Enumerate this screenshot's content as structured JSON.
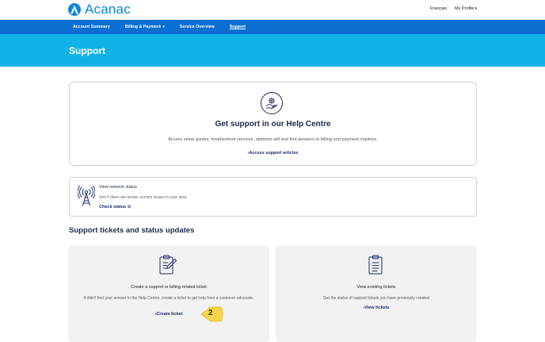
{
  "header": {
    "brand": "Acanac",
    "language_link": "Français",
    "profile_menu": "My Profile",
    "profile_chevron": "▾"
  },
  "nav": {
    "items": [
      {
        "label": "Account Summary"
      },
      {
        "label": "Billing & Payment"
      },
      {
        "label": "Service Overview"
      },
      {
        "label": "Support"
      }
    ],
    "billing_chevron": "▾"
  },
  "banner": {
    "title": "Support"
  },
  "help_centre": {
    "icon": "hand-gear-icon",
    "title": "Get support in our Help Centre",
    "description": "Access setup guides, troubleshoot services, optimize wifi and find answers to billing and payment inquiries.",
    "link": "›Access support articles"
  },
  "network_status": {
    "icon": "antenna-icon",
    "title": "View network status",
    "description": "See if there are known service issues in your area",
    "link": "Check status",
    "link_icon": "⊘"
  },
  "tickets": {
    "heading": "Support tickets and status updates",
    "create": {
      "icon": "clipboard-pencil-icon",
      "title": "Create a support or billing related ticket",
      "description": "If didn't find your answer in the Help Centre, create a ticket to get help from a customer advocate.",
      "link": "›Create ticket"
    },
    "view": {
      "icon": "clipboard-list-icon",
      "title": "View existing tickets",
      "description": "Get the status of support tickets you have previously created",
      "link": "›View tickets"
    }
  },
  "annotation": {
    "step": "2",
    "color": "#f7d54a"
  },
  "colors": {
    "brand_blue": "#0a86d8",
    "nav_blue": "#0a6fd0",
    "banner_cyan": "#11b3e7",
    "navy": "#1b2a6b"
  }
}
